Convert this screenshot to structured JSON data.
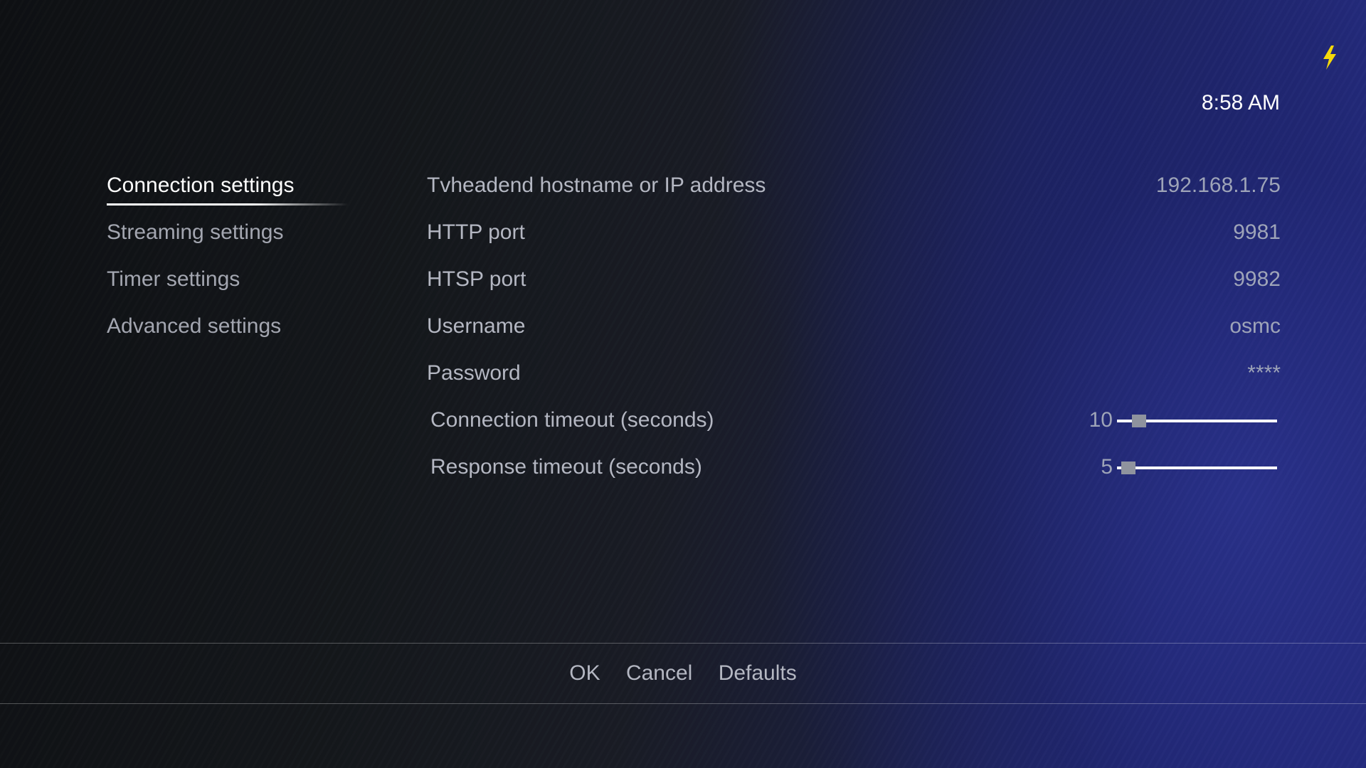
{
  "status": {
    "icon": "lightning-bolt-icon",
    "icon_color": "#f5d90a",
    "clock": "8:58 AM"
  },
  "sidebar": {
    "items": [
      {
        "label": "Connection settings",
        "active": true
      },
      {
        "label": "Streaming settings",
        "active": false
      },
      {
        "label": "Timer settings",
        "active": false
      },
      {
        "label": "Advanced settings",
        "active": false
      }
    ]
  },
  "settings": {
    "rows": [
      {
        "label": "Tvheadend hostname or IP address",
        "value": "192.168.1.75"
      },
      {
        "label": "HTTP port",
        "value": "9981"
      },
      {
        "label": "HTSP port",
        "value": "9982"
      },
      {
        "label": "Username",
        "value": "osmc"
      },
      {
        "label": "Password",
        "value": "****"
      }
    ],
    "sliders": [
      {
        "label": "Connection timeout (seconds)",
        "value": "10",
        "fraction": 0.1
      },
      {
        "label": "Response timeout (seconds)",
        "value": "5",
        "fraction": 0.03
      }
    ]
  },
  "buttons": {
    "ok": "OK",
    "cancel": "Cancel",
    "defaults": "Defaults"
  }
}
